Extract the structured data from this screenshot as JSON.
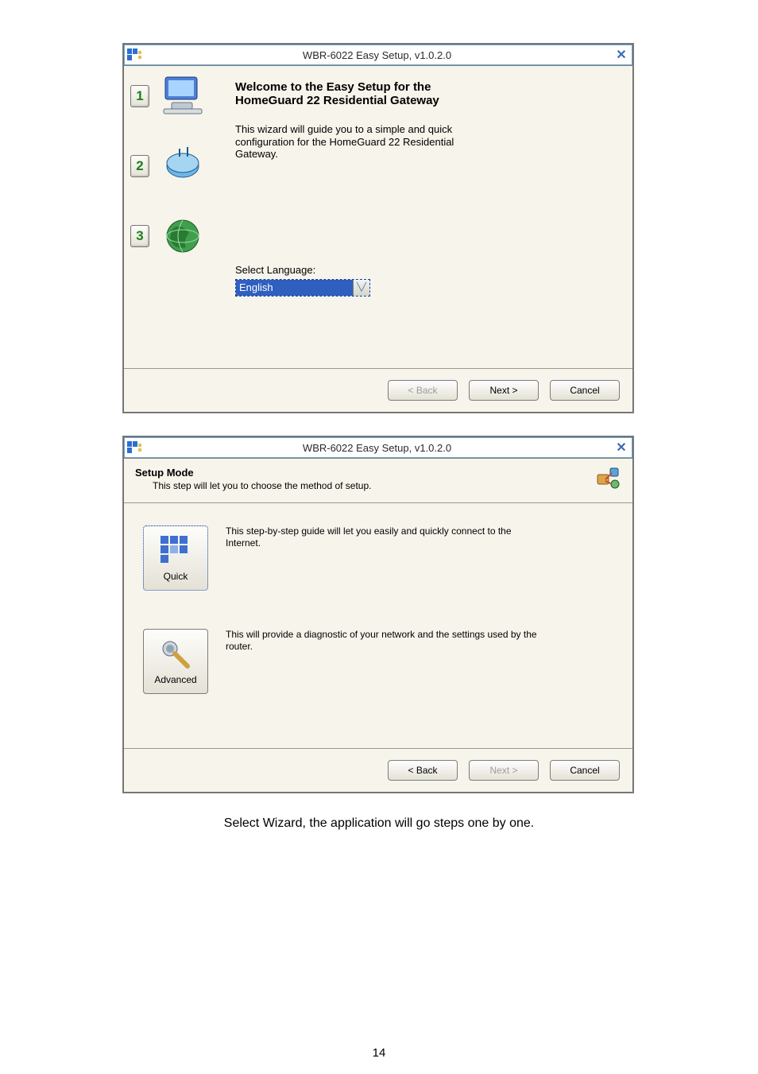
{
  "dialog1": {
    "title": "WBR-6022 Easy Setup, v1.0.2.0",
    "welcome_heading": "Welcome to the Easy Setup for the\nHomeGuard 22 Residential Gateway",
    "welcome_body": "This wizard will guide you to a simple and quick\nconfiguration for the HomeGuard 22 Residential\nGateway.",
    "language_label": "Select Language:",
    "language_value": "English",
    "buttons": {
      "back": "< Back",
      "next": "Next >",
      "cancel": "Cancel"
    },
    "steps": [
      "1",
      "2",
      "3"
    ]
  },
  "dialog2": {
    "title": "WBR-6022 Easy Setup, v1.0.2.0",
    "header_title": "Setup Mode",
    "header_sub": "This step will let you to choose the method of setup.",
    "modes": {
      "quick": {
        "label": "Quick",
        "desc": "This step-by-step guide will let you easily and quickly connect to the\nInternet."
      },
      "advanced": {
        "label": "Advanced",
        "desc": "This will provide a diagnostic of your network and the settings used by the\nrouter."
      }
    },
    "buttons": {
      "back": "< Back",
      "next": "Next >",
      "cancel": "Cancel"
    }
  },
  "caption": "Select Wizard, the application will go steps one by one.",
  "page_number": "14"
}
